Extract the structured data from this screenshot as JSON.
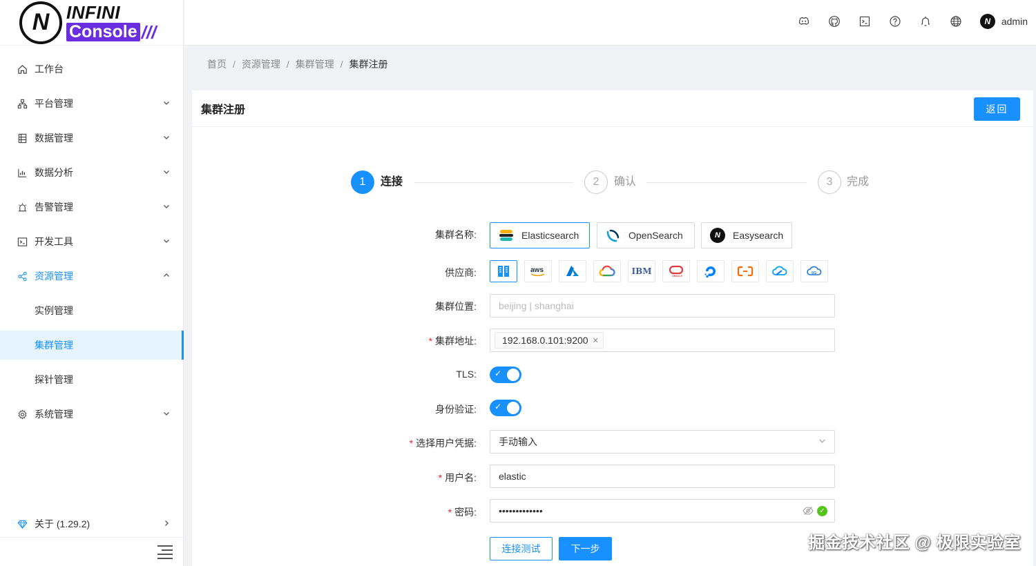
{
  "app": {
    "logo_top": "INFINI",
    "logo_bottom": "Console",
    "logo_slashes": "///",
    "logo_mark": "N"
  },
  "header": {
    "icons": [
      "discord-icon",
      "github-icon",
      "terminal-icon",
      "help-icon",
      "bell-icon",
      "globe-icon"
    ],
    "avatar_glyph": "N",
    "username": "admin"
  },
  "sidebar": {
    "items": [
      {
        "label": "工作台",
        "icon": "home-icon"
      },
      {
        "label": "平台管理",
        "icon": "cluster-icon"
      },
      {
        "label": "数据管理",
        "icon": "database-icon"
      },
      {
        "label": "数据分析",
        "icon": "chart-icon"
      },
      {
        "label": "告警管理",
        "icon": "alarm-icon"
      },
      {
        "label": "开发工具",
        "icon": "code-icon"
      },
      {
        "label": "资源管理",
        "icon": "share-icon"
      },
      {
        "label": "实例管理"
      },
      {
        "label": "集群管理"
      },
      {
        "label": "探针管理"
      },
      {
        "label": "系统管理",
        "icon": "settings-icon"
      }
    ],
    "about": "关于 (1.29.2)"
  },
  "breadcrumb": [
    "首页",
    "资源管理",
    "集群管理",
    "集群注册"
  ],
  "page": {
    "title": "集群注册",
    "back_label": "返回"
  },
  "steps": [
    {
      "num": "1",
      "label": "连接",
      "status": "active"
    },
    {
      "num": "2",
      "label": "确认",
      "status": "wait"
    },
    {
      "num": "3",
      "label": "完成",
      "status": "wait"
    }
  ],
  "form": {
    "cluster_name_label": "集群名称",
    "distributions": [
      {
        "label": "Elasticsearch",
        "selected": true
      },
      {
        "label": "OpenSearch",
        "selected": false
      },
      {
        "label": "Easysearch",
        "selected": false
      }
    ],
    "provider_label": "供应商",
    "providers": [
      "on-prem",
      "aws",
      "azure",
      "google-cloud",
      "ibm",
      "oracle",
      "digitalocean",
      "alibaba-cloud",
      "tencent-cloud",
      "huawei-cloud"
    ],
    "location_label": "集群位置",
    "location_placeholder": "beijing | shanghai",
    "address_label": "集群地址",
    "address_tag": "192.168.0.101:9200",
    "tls_label": "TLS",
    "auth_label": "身份验证",
    "credential_label": "选择用户凭据",
    "credential_value": "手动输入",
    "username_label": "用户名",
    "username_value": "elastic",
    "password_label": "密码",
    "password_value": "•••••••••••••",
    "test_button": "连接测试",
    "next_button": "下一步"
  },
  "watermark": "掘金技术社区 @ 极限实验室",
  "colors": {
    "primary": "#1890ff",
    "brand_purple": "#6b2de0",
    "success": "#52c41a",
    "required": "#f5222d"
  }
}
